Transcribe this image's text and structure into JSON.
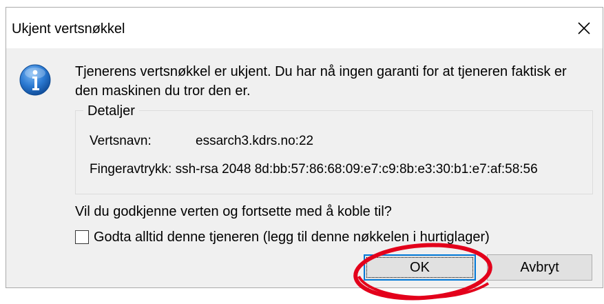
{
  "dialog": {
    "title": "Ukjent vertsnøkkel",
    "close_symbol": "✕",
    "icon": "info-icon",
    "message": "Tjenerens vertsnøkkel er ukjent. Du har nå ingen garanti for at tjeneren faktisk er den maskinen du tror den er.",
    "details": {
      "legend": "Detaljer",
      "host_label": "Vertsnavn:",
      "host_value": "essarch3.kdrs.no:22",
      "fingerprint_label": "Fingeravtrykk:",
      "fingerprint_value": "ssh-rsa 2048 8d:bb:57:86:68:09:e7:c9:8b:e3:30:b1:e7:af:58:56"
    },
    "question": "Vil du godkjenne verten og fortsette med å koble til?",
    "checkbox_label": "Godta alltid denne tjeneren (legg til denne nøkkelen i hurtiglager)",
    "checkbox_checked": false,
    "ok_label": "OK",
    "cancel_label": "Avbryt",
    "accent_color": "#0078d7",
    "annotation_color": "#e3001b"
  }
}
